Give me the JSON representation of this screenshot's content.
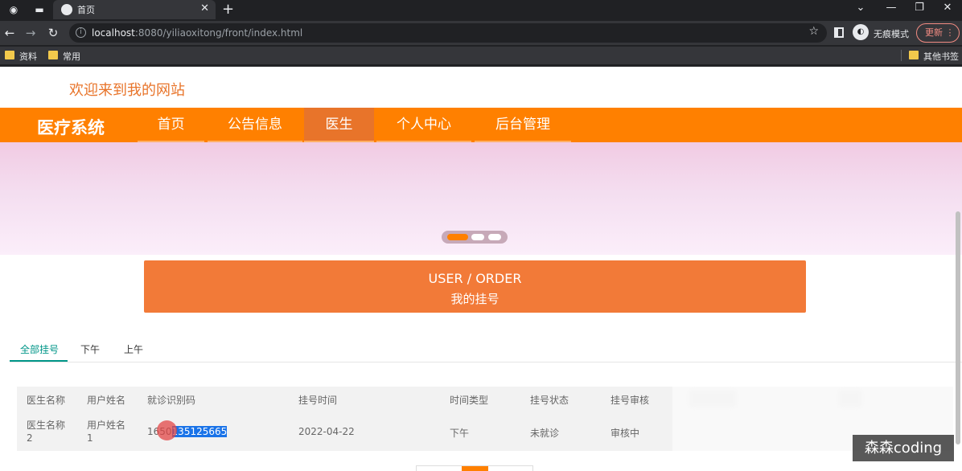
{
  "browser": {
    "tab_title": "首页",
    "url_host": "localhost",
    "url_path": ":8080/yiliaoxitong/front/index.html",
    "incognito_label": "无痕模式",
    "update_label": "更新",
    "bookmarks": [
      "资料",
      "常用"
    ],
    "other_bookmarks": "其他书签"
  },
  "site": {
    "welcome": "欢迎来到我的网站",
    "brand": "医疗系统",
    "nav": [
      "首页",
      "公告信息",
      "医生",
      "个人中心",
      "后台管理"
    ],
    "active_nav": "医生"
  },
  "order_card": {
    "en": "USER / ORDER",
    "zh": "我的挂号"
  },
  "filter_tabs": [
    "全部挂号",
    "下午",
    "上午"
  ],
  "table": {
    "headers": [
      "医生名称",
      "用户姓名",
      "就诊识别码",
      "挂号时间",
      "时间类型",
      "挂号状态",
      "挂号审核"
    ],
    "rows": [
      {
        "doctor": [
          "医生名称",
          "2"
        ],
        "user": [
          "用户姓名",
          "1"
        ],
        "code_prefix": "1650",
        "code_selected": "135125665",
        "time": "2022-04-22",
        "time_type": "下午",
        "status": "未就诊",
        "review": "审核中"
      }
    ]
  },
  "watermark": "森森coding"
}
